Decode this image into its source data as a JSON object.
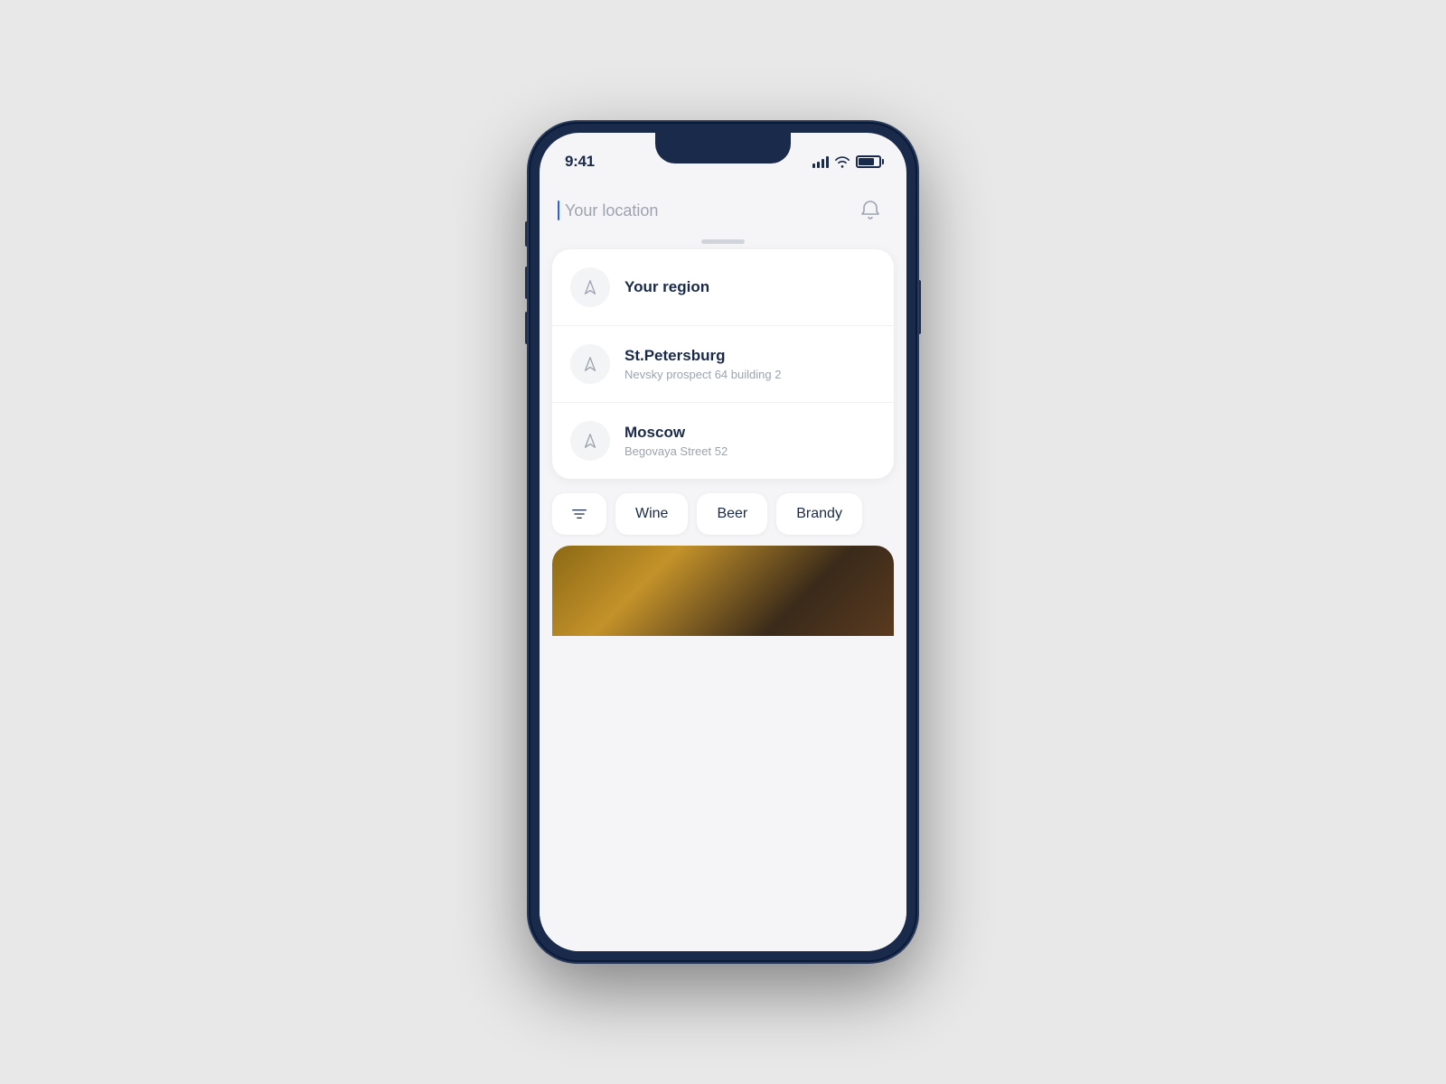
{
  "status": {
    "time": "9:41",
    "signal_bars": 4,
    "wifi": true,
    "battery_percent": 75
  },
  "header": {
    "location_placeholder": "Your location",
    "bell_label": "notifications"
  },
  "location_list": {
    "items": [
      {
        "id": "region",
        "name": "Your region",
        "address": ""
      },
      {
        "id": "spb",
        "name": "St.Petersburg",
        "address": "Nevsky prospect 64 building 2"
      },
      {
        "id": "moscow",
        "name": "Moscow",
        "address": "Begovaya Street 52"
      }
    ]
  },
  "categories": {
    "filter_label": "filter",
    "items": [
      {
        "id": "wine",
        "label": "Wine"
      },
      {
        "id": "beer",
        "label": "Beer"
      },
      {
        "id": "brandy",
        "label": "Brandy"
      }
    ]
  }
}
